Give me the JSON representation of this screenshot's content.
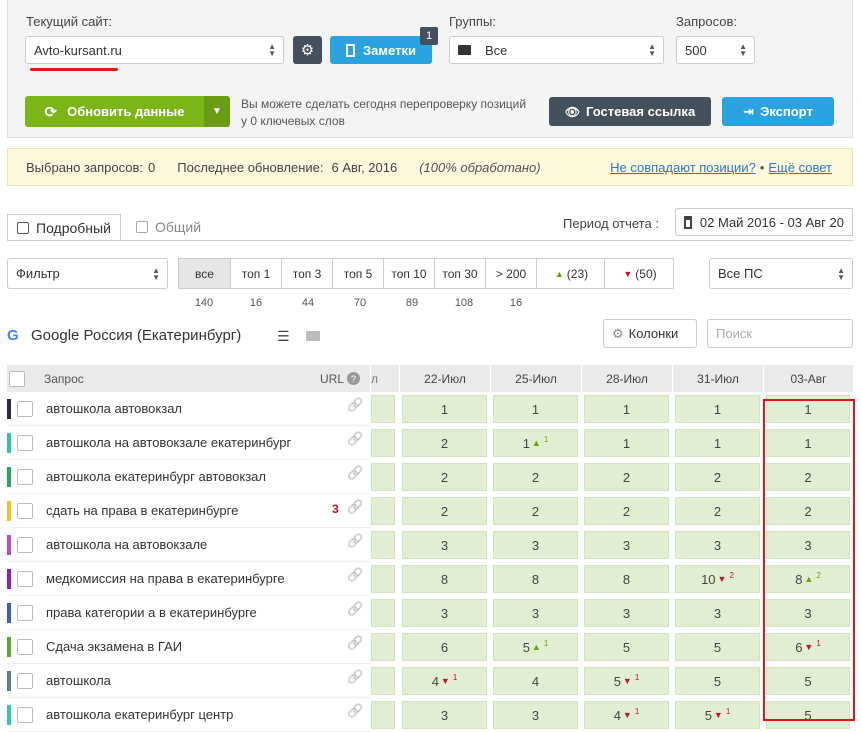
{
  "header": {
    "site_label": "Текущий сайт:",
    "site_value": "Avto-kursant.ru",
    "notes_label": "Заметки",
    "notes_badge": "1",
    "groups_label": "Группы:",
    "groups_value": "Все",
    "queries_label": "Запросов:",
    "queries_value": "500",
    "update_label": "Обновить данные",
    "recheck_text_1": "Вы можете сделать сегодня перепроверку позиций",
    "recheck_text_2": "у 0 ключевых слов",
    "guest_link_label": "Гостевая ссылка",
    "export_label": "Экспорт"
  },
  "info": {
    "selected_label": "Выбрано запросов:",
    "selected_value": "0",
    "last_update_label": "Последнее обновление:",
    "last_update_value": "6 Авг, 2016",
    "processed": "(100% обработано)",
    "mismatch_link": "Не совпадают позиции?",
    "sep": "•",
    "more_tips_link": "Ещё совет"
  },
  "tabs": {
    "detailed": "Подробный",
    "general": "Общий"
  },
  "period": {
    "label": "Период отчета :",
    "value": "02 Май 2016 - 03 Авг 20"
  },
  "filter": {
    "placeholder": "Фильтр",
    "buttons": [
      {
        "label": "все",
        "count": "140"
      },
      {
        "label": "топ 1",
        "count": "16"
      },
      {
        "label": "топ 3",
        "count": "44"
      },
      {
        "label": "топ 5",
        "count": "70"
      },
      {
        "label": "топ 10",
        "count": "89"
      },
      {
        "label": "топ 30",
        "count": "108"
      },
      {
        "label": "> 200",
        "count": "16"
      },
      {
        "label": "(23)",
        "count": ""
      },
      {
        "label": "(50)",
        "count": ""
      }
    ],
    "ps_value": "Все ПС"
  },
  "engine": {
    "title": "Google Россия (Екатеринбург)",
    "columns_label": "Колонки",
    "search_placeholder": "Поиск"
  },
  "table": {
    "col_query": "Запрос",
    "col_url": "URL",
    "col_partial": "л",
    "dates": [
      "22-Июл",
      "25-Июл",
      "28-Июл",
      "31-Июл",
      "03-Авг"
    ],
    "rows": [
      {
        "query": "автошкола автовокзал",
        "color": "#2d2d3a",
        "badge": "",
        "vals": [
          "1",
          "1",
          "1",
          "1",
          "1"
        ]
      },
      {
        "query": "автошкола на автовокзале екатеринбург",
        "color": "#2ec4a6",
        "badge": "",
        "vals": [
          "2",
          "1",
          "1",
          "1",
          "1"
        ]
      },
      {
        "query": "автошкола екатеринбург автовокзал",
        "color": "#27a85a",
        "badge": "",
        "vals": [
          "2",
          "2",
          "2",
          "2",
          "2"
        ]
      },
      {
        "query": "сдать на права в екатеринбурге",
        "color": "#f0c419",
        "badge": "3",
        "vals": [
          "2",
          "2",
          "2",
          "2",
          "2"
        ]
      },
      {
        "query": "автошкола на автовокзале",
        "color": "#b44fc2",
        "badge": "",
        "vals": [
          "3",
          "3",
          "3",
          "3",
          "3"
        ]
      },
      {
        "query": "медкомиссия на права в екатеринбурге",
        "color": "#8a1fc4",
        "badge": "",
        "vals": [
          "8",
          "8",
          "8",
          "10",
          "8"
        ]
      },
      {
        "query": "права категории а в екатеринбурге",
        "color": "#3a5fbf",
        "badge": "",
        "vals": [
          "3",
          "3",
          "3",
          "3",
          "3"
        ]
      },
      {
        "query": "Сдача экзамена в ГАИ",
        "color": "#5aa836",
        "badge": "",
        "vals": [
          "6",
          "5",
          "5",
          "5",
          "6"
        ]
      },
      {
        "query": "автошкола",
        "color": "#5f7f8a",
        "badge": "",
        "vals": [
          "4",
          "4",
          "5",
          "5",
          "5"
        ]
      },
      {
        "query": "автошкола екатеринбург центр",
        "color": "#33c6b0",
        "badge": "",
        "vals": [
          "3",
          "3",
          "4",
          "5",
          "5"
        ]
      }
    ],
    "changes": [
      {
        "row": 1,
        "col": 1,
        "dir": "up",
        "n": "1"
      },
      {
        "row": 5,
        "col": 3,
        "dir": "down",
        "n": "2"
      },
      {
        "row": 5,
        "col": 4,
        "dir": "up",
        "n": "2"
      },
      {
        "row": 7,
        "col": 1,
        "dir": "up",
        "n": "1"
      },
      {
        "row": 7,
        "col": 4,
        "dir": "down",
        "n": "1"
      },
      {
        "row": 8,
        "col": 0,
        "dir": "down",
        "n": "1"
      },
      {
        "row": 8,
        "col": 2,
        "dir": "down",
        "n": "1"
      },
      {
        "row": 9,
        "col": 2,
        "dir": "down",
        "n": "1"
      },
      {
        "row": 9,
        "col": 3,
        "dir": "down",
        "n": "1"
      }
    ]
  },
  "colors": {
    "green": "#7cb518",
    "blue": "#2aa3e0",
    "dark": "#44505c",
    "highlight": "#e0161b"
  }
}
